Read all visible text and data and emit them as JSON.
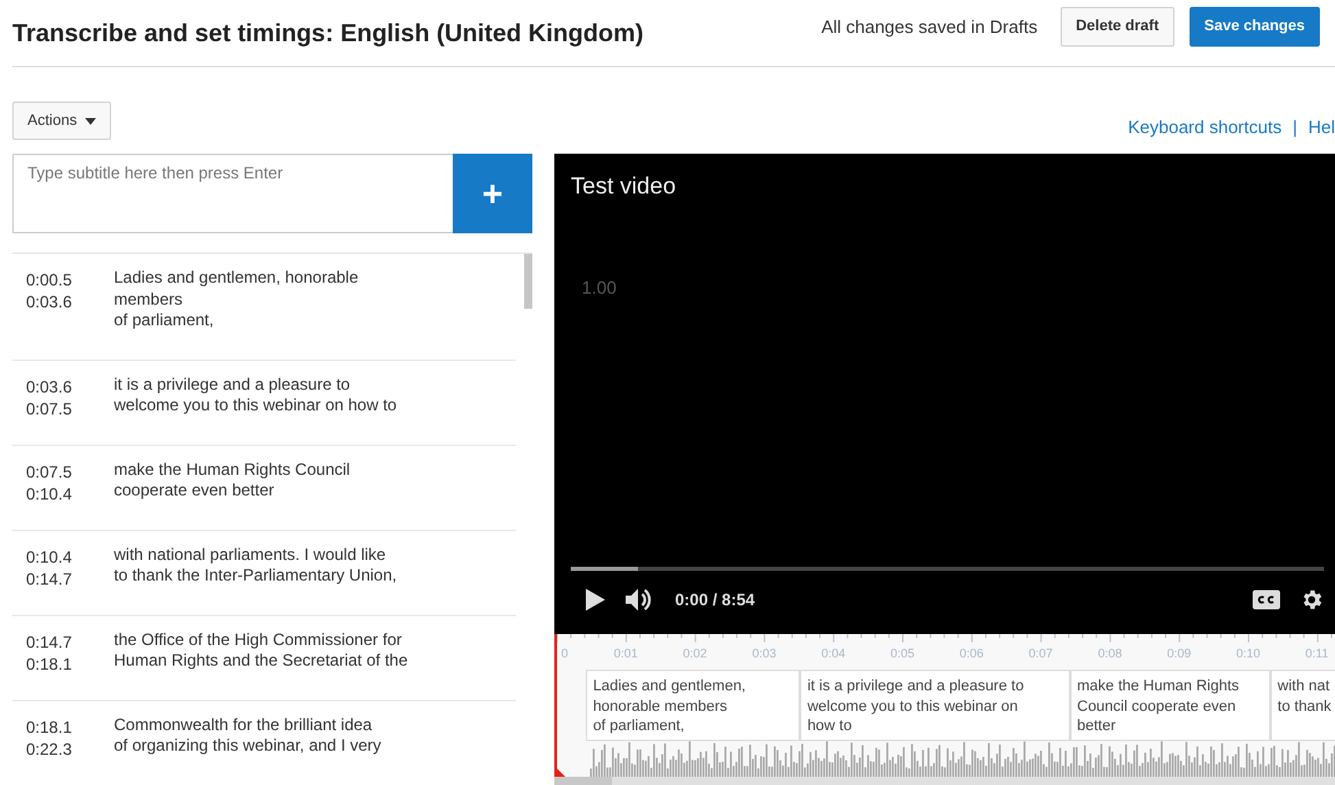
{
  "header": {
    "title": "Transcribe and set timings: English (United Kingdom)",
    "status": "All changes saved in Drafts",
    "buttons": [
      {
        "label": "Delete draft",
        "kind": "secondary"
      },
      {
        "label": "Save changes",
        "kind": "primary"
      }
    ]
  },
  "toolbar": {
    "actions": "Actions",
    "links": [
      "Keyboard shortcuts",
      "Hel"
    ],
    "separator": "|"
  },
  "subtitle_input": {
    "placeholder": "Type subtitle here then press Enter",
    "add": "+"
  },
  "captions": [
    {
      "start": "0:00.5",
      "end": "0:03.6",
      "lines": [
        "Ladies and gentlemen, honorable",
        "members",
        "of parliament,"
      ]
    },
    {
      "start": "0:03.6",
      "end": "0:07.5",
      "lines": [
        "it is a privilege and a pleasure to",
        "welcome you to this webinar on how to"
      ]
    },
    {
      "start": "0:07.5",
      "end": "0:10.4",
      "lines": [
        "make the Human Rights Council",
        "cooperate even better"
      ]
    },
    {
      "start": "0:10.4",
      "end": "0:14.7",
      "lines": [
        "with national parliaments. I would like",
        "to thank the Inter-Parliamentary Union,"
      ]
    },
    {
      "start": "0:14.7",
      "end": "0:18.1",
      "lines": [
        "the Office of the High Commissioner for",
        "Human Rights and the Secretariat of the"
      ]
    },
    {
      "start": "0:18.1",
      "end": "0:22.3",
      "lines": [
        "Commonwealth for the brilliant idea",
        "of organizing this webinar, and I very"
      ]
    }
  ],
  "video": {
    "title": "Test video",
    "speed": "1.00",
    "time": "0:00 / 8:54",
    "progress": {
      "level": 0.09
    }
  },
  "timeline": {
    "ticks": [
      "0",
      "0:01",
      "0:02",
      "0:03",
      "0:04",
      "0:05",
      "0:06",
      "0:07",
      "0:08",
      "0:09",
      "0:10",
      "0:11"
    ],
    "cues": [
      {
        "lines": [
          "Ladies and gentlemen,",
          "honorable members",
          "of parliament,"
        ]
      },
      {
        "lines": [
          "it is a privilege and a pleasure to",
          "welcome you to this webinar on",
          "how to"
        ]
      },
      {
        "lines": [
          "make the Human Rights",
          "Council cooperate even",
          "better"
        ]
      },
      {
        "lines": [
          "with nat",
          "to thank"
        ]
      }
    ]
  }
}
